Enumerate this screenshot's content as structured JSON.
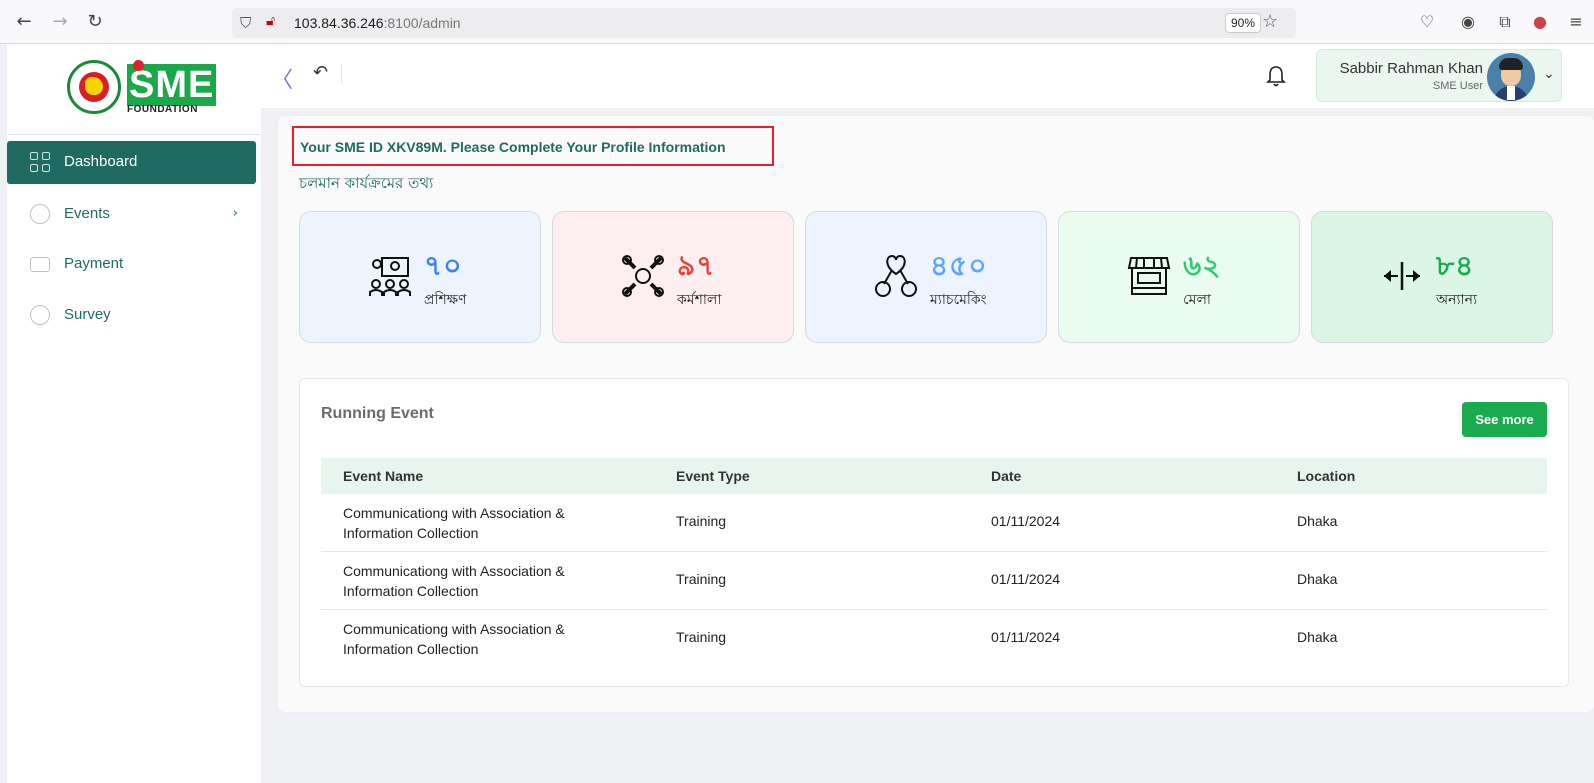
{
  "browser": {
    "url_host": "103.84.36.246",
    "url_rest": ":8100/admin",
    "zoom": "90%"
  },
  "sidebar": {
    "logo": {
      "brand": "SME",
      "foundation": "FOUNDATION"
    },
    "items": [
      {
        "label": "Dashboard",
        "active": true
      },
      {
        "label": "Events",
        "has_children": true
      },
      {
        "label": "Payment"
      },
      {
        "label": "Survey"
      }
    ]
  },
  "header": {
    "user_name": "Sabbir Rahman Khan",
    "user_role": "SME User"
  },
  "main": {
    "notice": "Your SME ID XKV89M. Please Complete Your Profile Information",
    "section_title": "চলমান কার্যক্রমের তথ্য",
    "stats": [
      {
        "value": "৭০",
        "label": "প্রশিক্ষণ",
        "color": "#3b82f6",
        "bg": "#eef4fe"
      },
      {
        "value": "৯৭",
        "label": "কর্মশালা",
        "color": "#e2453c",
        "bg": "#fdefef"
      },
      {
        "value": "৪৫০",
        "label": "ম্যাচমেকিং",
        "color": "#60a5fa",
        "bg": "#edf4ff"
      },
      {
        "value": "৬২",
        "label": "মেলা",
        "color": "#2ecc71",
        "bg": "#eafbef"
      },
      {
        "value": "৮৪",
        "label": "অন্যান্য",
        "color": "#1aab4e",
        "bg": "#dcf6e5"
      }
    ],
    "running_event": {
      "title": "Running Event",
      "see_more": "See more",
      "columns": [
        "Event Name",
        "Event Type",
        "Date",
        "Location"
      ],
      "rows": [
        [
          "Communicationg with Association & Information Collection",
          "Training",
          "01/11/2024",
          "Dhaka"
        ],
        [
          "Communicationg with Association & Information Collection",
          "Training",
          "01/11/2024",
          "Dhaka"
        ],
        [
          "Communicationg with Association & Information Collection",
          "Training",
          "01/11/2024",
          "Dhaka"
        ]
      ]
    }
  }
}
